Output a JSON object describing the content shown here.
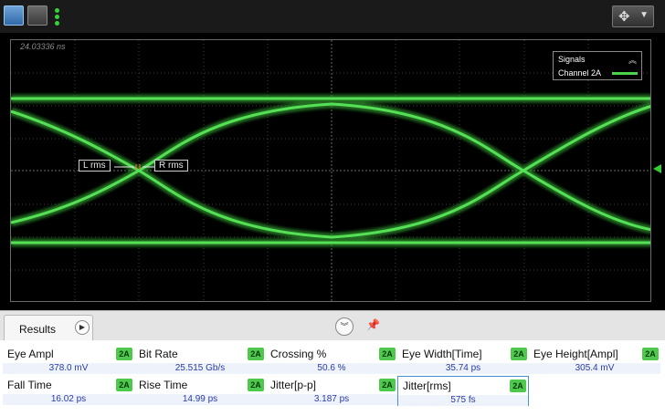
{
  "toolbar": {
    "pan_icon": "pan-move-icon",
    "dropdown_icon": "chevron-down-icon"
  },
  "display": {
    "timestamp": "24.03336 ns",
    "legend_title": "Signals",
    "legend_channel": "Channel 2A",
    "trace_color": "#4cd24c",
    "marker_left": "L rms",
    "marker_right": "R rms"
  },
  "results": {
    "tab_label": "Results",
    "items": [
      {
        "name": "Eye Ampl",
        "badge": "2A",
        "value": "378.0 mV"
      },
      {
        "name": "Bit Rate",
        "badge": "2A",
        "value": "25.515 Gb/s"
      },
      {
        "name": "Crossing %",
        "badge": "2A",
        "value": "50.6 %"
      },
      {
        "name": "Eye Width[Time]",
        "badge": "2A",
        "value": "35.74 ps"
      },
      {
        "name": "Eye Height[Ampl]",
        "badge": "2A",
        "value": "305.4 mV"
      },
      {
        "name": "Fall Time",
        "badge": "2A",
        "value": "16.02 ps"
      },
      {
        "name": "Rise Time",
        "badge": "2A",
        "value": "14.99 ps"
      },
      {
        "name": "Jitter[p-p]",
        "badge": "2A",
        "value": "3.187 ps"
      },
      {
        "name": "Jitter[rms]",
        "badge": "2A",
        "value": "575 fs"
      }
    ]
  }
}
